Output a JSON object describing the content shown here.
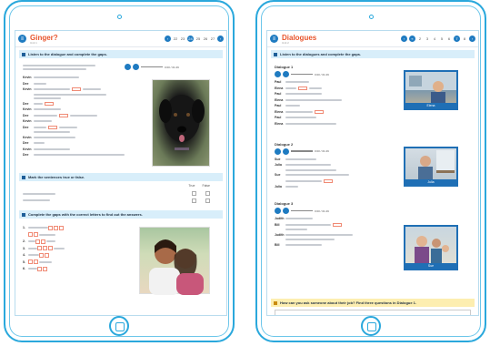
{
  "left": {
    "title": "Ginger?",
    "subtitle": "Unit 1",
    "pages": [
      "22",
      "23",
      "24",
      "25",
      "26",
      "27"
    ],
    "current_page": "24",
    "band1": "Listen to the dialogue and complete the gaps.",
    "time": "0:00 / 01:29",
    "speakers": [
      "Kevin",
      "Dee",
      "Kevin",
      "Dee",
      "Kevin",
      "Dee",
      "Kevin",
      "Dee",
      "Kevin",
      "Dee",
      "Kevin",
      "Dee",
      "Kevin",
      "Dee"
    ],
    "band2": "Mark the sentences true or false.",
    "tf_headers": [
      "True",
      "False"
    ],
    "band3": "Complete the gaps with the correct letters to find out the answers.",
    "numbers": [
      "1.",
      "2.",
      "3.",
      "4.",
      "5.",
      "6."
    ]
  },
  "right": {
    "title": "Dialogues",
    "subtitle": "Unit 2",
    "pages": [
      "2",
      "3",
      "4",
      "5",
      "6",
      "7",
      "8"
    ],
    "current_page": "7",
    "band1": "Listen to the dialogues and complete the gaps.",
    "d1": "Dialogue 1",
    "d2": "Dialogue 2",
    "d3": "Dialogue 3",
    "time": "0:00 / 01:29",
    "cap1": "Elena",
    "cap2": "Julia",
    "cap3": "Sue",
    "d1_speakers": [
      "Paul",
      "Elena",
      "Paul",
      "Elena",
      "Paul",
      "Elena",
      "Paul",
      "Elena"
    ],
    "d2_speakers": [
      "Sue",
      "Julia",
      "Sue",
      "Julia",
      "Sue"
    ],
    "d3_speakers": [
      "Judith",
      "Bill",
      "Judith",
      "Bill"
    ],
    "band2": "How can you ask someone about their job? Find three questions in Dialogue 1."
  },
  "colors": {
    "accent": "#1f7bc1",
    "title": "#e8542c",
    "frame": "#2aa8dc"
  }
}
